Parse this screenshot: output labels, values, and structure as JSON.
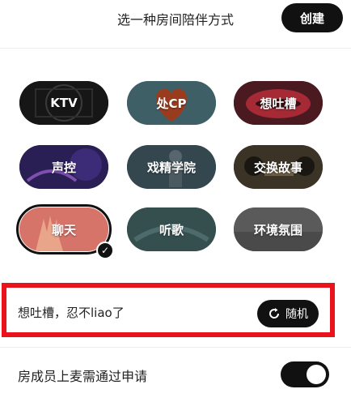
{
  "header": {
    "title": "选一种房间陪伴方式",
    "create_label": "创建"
  },
  "modes": [
    {
      "label": "KTV",
      "selected": false
    },
    {
      "label": "处CP",
      "selected": false
    },
    {
      "label": "想吐槽",
      "selected": false
    },
    {
      "label": "声控",
      "selected": false
    },
    {
      "label": "戏精学院",
      "selected": false
    },
    {
      "label": "交换故事",
      "selected": false
    },
    {
      "label": "聊天",
      "selected": true
    },
    {
      "label": "听歌",
      "selected": false
    },
    {
      "label": "环境氛围",
      "selected": false
    }
  ],
  "topic": {
    "text": "想吐槽，忍不liao了",
    "random_label": "随机"
  },
  "settings": {
    "approve_label": "房成员上麦需通过申请",
    "approve_enabled": true
  },
  "colors": {
    "accent": "#111111",
    "highlight_border": "#e8131b"
  }
}
